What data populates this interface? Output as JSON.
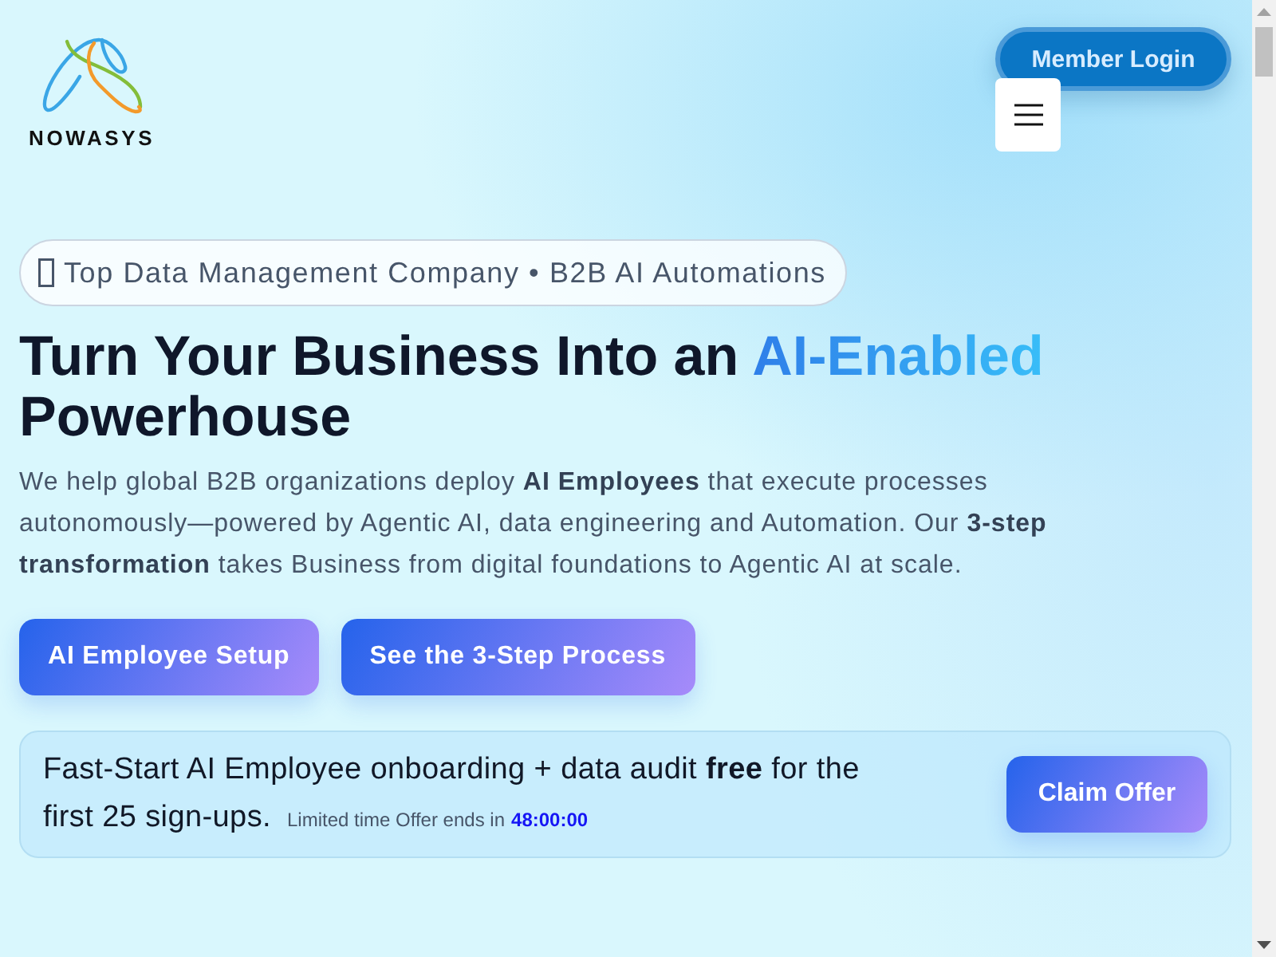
{
  "header": {
    "logo": {
      "wordmark": "NOWASYS"
    },
    "login_button": "Member Login"
  },
  "badge": {
    "text": "Top Data Management Company • B2B AI Automations"
  },
  "hero": {
    "title_before": "Turn Your Business Into an ",
    "title_highlight": "AI-Enabled",
    "title_after": "Powerhouse",
    "description": "We help global B2B organizations deploy **AI Employees** that execute processes autonomously—powered by Agentic AI, data engineering and Automation. Our **3-step transformation** takes Business from digital foundations to Agentic AI at scale.",
    "buttons": [
      {
        "label": "AI Employee Setup"
      },
      {
        "label": "See the 3-Step Process"
      }
    ]
  },
  "offer": {
    "text": "Fast-Start AI Employee onboarding + data audit **free** for the first 25 sign-ups.",
    "note": "Limited time Offer ends in",
    "countdown": "48:00:00",
    "button": "Claim Offer"
  }
}
